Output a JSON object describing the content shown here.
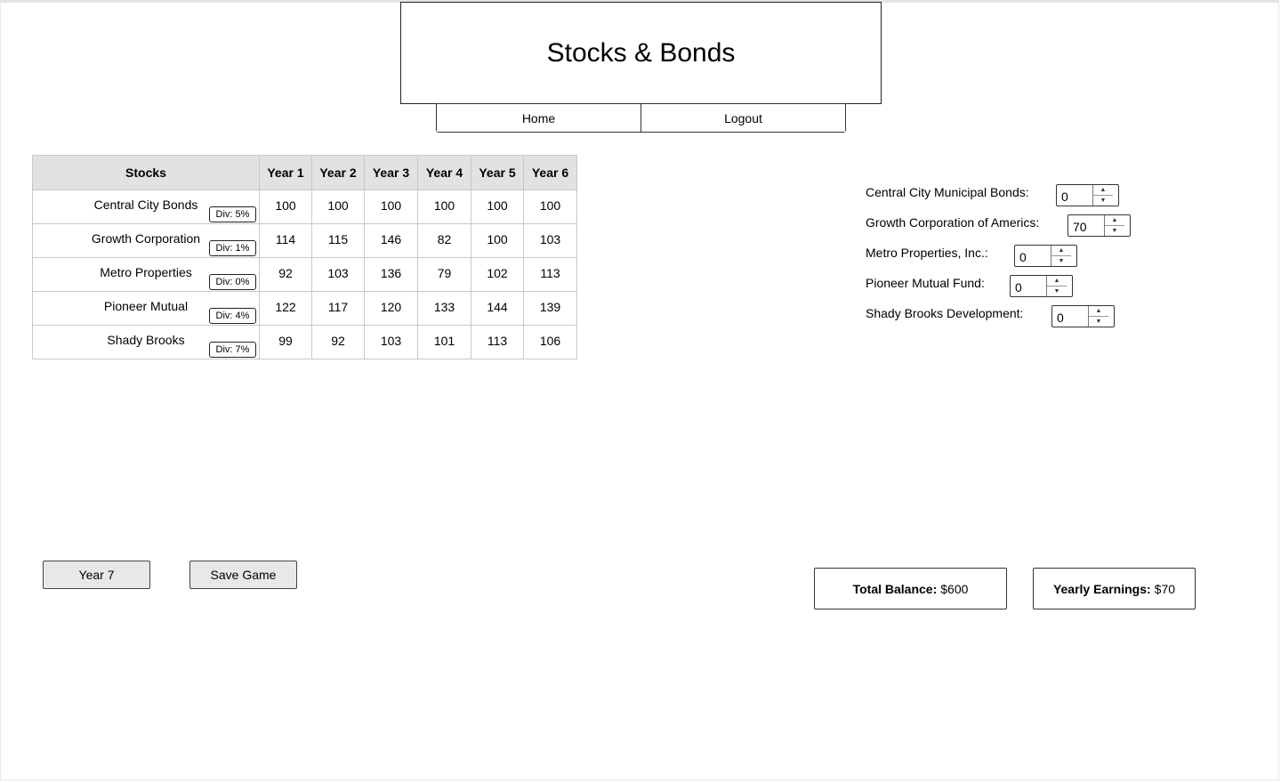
{
  "app": {
    "title": "Stocks & Bonds"
  },
  "nav": {
    "home_label": "Home",
    "logout_label": "Logout"
  },
  "table": {
    "header_stocks": "Stocks",
    "years": [
      "Year 1",
      "Year 2",
      "Year 3",
      "Year 4",
      "Year 5",
      "Year 6"
    ],
    "rows": [
      {
        "name": "Central City Bonds",
        "dividend": "Div: 5%",
        "values": [
          "100",
          "100",
          "100",
          "100",
          "100",
          "100"
        ]
      },
      {
        "name": "Growth Corporation",
        "dividend": "Div: 1%",
        "values": [
          "114",
          "115",
          "146",
          "82",
          "100",
          "103"
        ]
      },
      {
        "name": "Metro Properties",
        "dividend": "Div: 0%",
        "values": [
          "92",
          "103",
          "136",
          "79",
          "102",
          "113"
        ]
      },
      {
        "name": "Pioneer Mutual",
        "dividend": "Div: 4%",
        "values": [
          "122",
          "117",
          "120",
          "133",
          "144",
          "139"
        ]
      },
      {
        "name": "Shady Brooks",
        "dividend": "Div: 7%",
        "values": [
          "99",
          "92",
          "103",
          "101",
          "113",
          "106"
        ]
      }
    ]
  },
  "investments": [
    {
      "label": "Central City Municipal Bonds:",
      "value": "0"
    },
    {
      "label": "Growth Corporation of Americs:",
      "value": "70"
    },
    {
      "label": "Metro Properties, Inc.:",
      "value": "0"
    },
    {
      "label": "Pioneer Mutual Fund:",
      "value": "0"
    },
    {
      "label": "Shady Brooks Development:",
      "value": "0"
    }
  ],
  "actions": {
    "next_year_label": "Year 7",
    "save_label": "Save Game"
  },
  "summary": {
    "balance_label": "Total Balance:",
    "balance_value": "$600",
    "earnings_label": "Yearly Earnings:",
    "earnings_value": "$70"
  },
  "icons": {
    "spinner_up": "chevron-up-icon",
    "spinner_down": "chevron-down-icon"
  }
}
